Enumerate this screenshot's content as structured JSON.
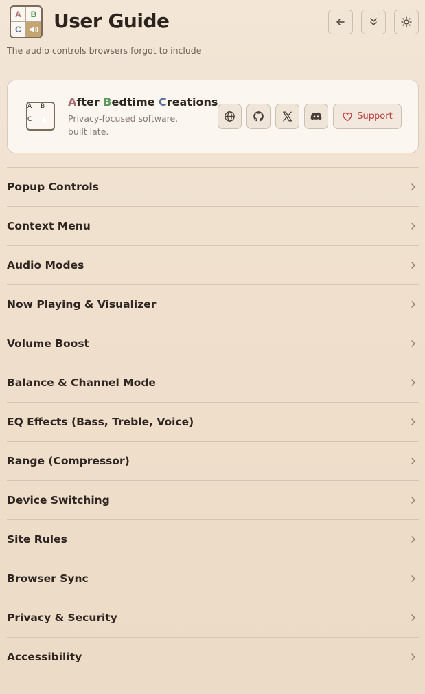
{
  "header": {
    "title": "User Guide",
    "subtitle": "The audio controls browsers forgot to include",
    "logo": {
      "a": "A",
      "b": "B",
      "c": "C",
      "d_icon": "speaker-icon"
    },
    "buttons": {
      "back_icon": "arrow-left-icon",
      "collapse_icon": "double-chevron-down-icon",
      "theme_icon": "sun-icon"
    }
  },
  "brand_card": {
    "name_parts": {
      "a": "A",
      "after": "fter ",
      "b": "B",
      "bedtime": "edtime ",
      "c": "C",
      "creations": "reations"
    },
    "tagline": "Privacy-focused software, built late.",
    "mini_logo": {
      "a": "A",
      "b": "B",
      "c": "C",
      "d_icon": "moon-icon"
    },
    "social_icons": [
      "globe-icon",
      "github-icon",
      "x-icon",
      "discord-icon"
    ],
    "support_label": "Support"
  },
  "sections": [
    {
      "label": "Popup Controls"
    },
    {
      "label": "Context Menu"
    },
    {
      "label": "Audio Modes"
    },
    {
      "label": "Now Playing & Visualizer"
    },
    {
      "label": "Volume Boost"
    },
    {
      "label": "Balance & Channel Mode"
    },
    {
      "label": "EQ Effects (Bass, Treble, Voice)"
    },
    {
      "label": "Range (Compressor)"
    },
    {
      "label": "Device Switching"
    },
    {
      "label": "Site Rules"
    },
    {
      "label": "Browser Sync"
    },
    {
      "label": "Privacy & Security"
    },
    {
      "label": "Accessibility"
    }
  ],
  "colors": {
    "accent_a": "#a86a6a",
    "accent_b": "#5b9a5b",
    "accent_c": "#5a6f9a",
    "support": "#b94040"
  }
}
